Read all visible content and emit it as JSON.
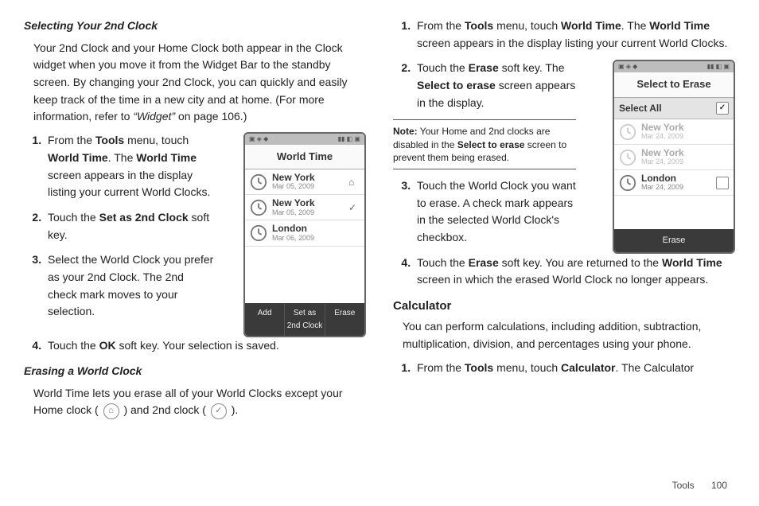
{
  "left": {
    "h1": "Selecting Your 2nd Clock",
    "intro_a": "Your 2nd Clock and your Home Clock both appear in the Clock widget when you move it from the Widget Bar to the standby screen. By changing your 2nd Clock, you can quickly and easily keep track of the time in a new city and at home. (For more information, refer to ",
    "intro_ref": "“Widget”",
    "intro_b": "  on page 106.)",
    "s1": {
      "a": "From the ",
      "b1": "Tools",
      "c": " menu, touch ",
      "b2": "World Time",
      "d": ". The ",
      "b3": "World Time",
      "e": " screen appears in the display listing your current World Clocks."
    },
    "s2": {
      "a": "Touch the ",
      "b1": "Set as 2nd Clock",
      "c": " soft key."
    },
    "s3": "Select the World Clock you prefer as your 2nd Clock. The 2nd check mark moves to your selection.",
    "s4": {
      "a": "Touch the ",
      "b1": "OK",
      "c": " soft key. Your selection is saved."
    },
    "h2": "Erasing a World Clock",
    "erase_a": "World Time lets you erase all of your World Clocks except your Home clock ( ",
    "erase_b": " ) and 2nd clock ( ",
    "erase_c": " )."
  },
  "right": {
    "s1": {
      "a": "From the ",
      "b1": "Tools",
      "c": " menu, touch ",
      "b2": "World Time",
      "d": ". The ",
      "b3": "World Time",
      "e": " screen appears in the display listing your current World Clocks."
    },
    "s2": {
      "a": "Touch the ",
      "b1": "Erase",
      "c": " soft key. The ",
      "b2": "Select to erase",
      "d": " screen appears in the display."
    },
    "note": {
      "label": "Note:",
      "a": " Your Home and 2nd clocks are disabled in the ",
      "b1": "Select to erase",
      "c": " screen to prevent them being erased."
    },
    "s3": "Touch the World Clock you want to erase. A check mark appears in the selected World Clock's checkbox.",
    "s4": {
      "a": "Touch the ",
      "b1": "Erase",
      "c": " soft key. You are returned to the ",
      "b2": "World Time",
      "d": " screen in which the erased World Clock no longer appears."
    },
    "h_calc": "Calculator",
    "calc_intro": "You can perform calculations, including addition, subtraction, multiplication, division, and percentages using your phone.",
    "calc_s1": {
      "a": "From the ",
      "b1": "Tools",
      "c": " menu, touch ",
      "b2": "Calculator",
      "d": ". The Calculator"
    }
  },
  "phoneA": {
    "title": "World Time",
    "rows": [
      {
        "city": "New York",
        "date": "Mar 05, 2009",
        "mark": "⌂"
      },
      {
        "city": "New York",
        "date": "Mar 05, 2009",
        "mark": "✓"
      },
      {
        "city": "London",
        "date": "Mar 06, 2009",
        "mark": ""
      }
    ],
    "soft": [
      "Add",
      "Set as\n2nd Clock",
      "Erase"
    ]
  },
  "phoneB": {
    "title": "Select to Erase",
    "selectAll": "Select All",
    "rows": [
      {
        "city": "New York",
        "date": "Mar 24, 2009",
        "dim": true
      },
      {
        "city": "New York",
        "date": "Mar 24, 2009",
        "dim": true
      },
      {
        "city": "London",
        "date": "Mar 24, 2009",
        "dim": false
      }
    ],
    "soft": "Erase"
  },
  "footer": {
    "section": "Tools",
    "page": "100"
  }
}
